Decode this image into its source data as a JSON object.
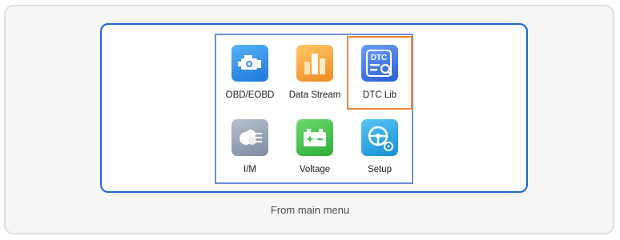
{
  "menu": {
    "items": [
      {
        "label": "OBD/EOBD",
        "icon": "engine-icon",
        "color": "#2e8ee8",
        "selected": false
      },
      {
        "label": "Data Stream",
        "icon": "bar-chart-icon",
        "color": "#f5a33a",
        "selected": false
      },
      {
        "label": "DTC Lib",
        "icon": "dtc-library-icon",
        "icon_text": "DTC",
        "color": "#3f74e0",
        "selected": true
      },
      {
        "label": "I/M",
        "icon": "emissions-icon",
        "color": "#8f9aac",
        "selected": false
      },
      {
        "label": "Voltage",
        "icon": "battery-icon",
        "color": "#3fc24a",
        "selected": false
      },
      {
        "label": "Setup",
        "icon": "steering-wheel-settings-icon",
        "color": "#22a8e6",
        "selected": false
      }
    ]
  },
  "caption": "From main menu",
  "colors": {
    "screen_border": "#1a67d8",
    "panel_border": "#6c8fd6",
    "selection_border": "#ef8630"
  }
}
